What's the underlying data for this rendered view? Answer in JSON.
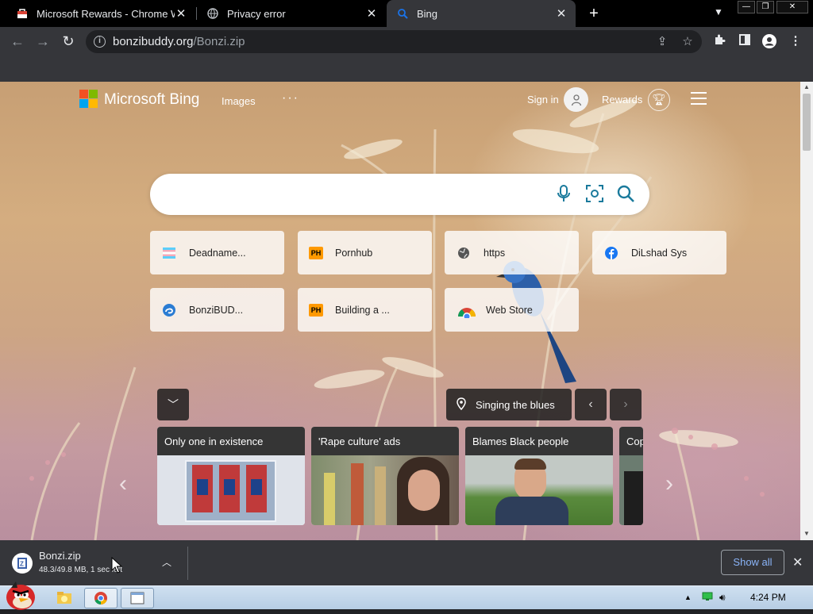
{
  "tabs": [
    {
      "title": "Microsoft Rewards - Chrome W",
      "active": false
    },
    {
      "title": "Privacy error",
      "active": false
    },
    {
      "title": "Bing",
      "active": true
    }
  ],
  "window_controls": {
    "minimize": "—",
    "restore": "❐",
    "close": "✕"
  },
  "address": {
    "domain": "bonzibuddy.org",
    "path": "/Bonzi.zip"
  },
  "bing": {
    "brand": "Microsoft Bing",
    "images_link": "Images",
    "more": "···",
    "signin": "Sign in",
    "rewards": "Rewards",
    "search_placeholder": ""
  },
  "quick_links": [
    {
      "label": "Deadname...",
      "icon": "trans-flag-icon"
    },
    {
      "label": "Pornhub",
      "icon": "ph-icon"
    },
    {
      "label": "https",
      "icon": "globe-icon"
    },
    {
      "label": "DiLshad Sys",
      "icon": "facebook-icon"
    },
    {
      "label": "BonziBUD...",
      "icon": "edge-icon"
    },
    {
      "label": "Building a ...",
      "icon": "ph-icon"
    },
    {
      "label": "Web Store",
      "icon": "chrome-icon"
    }
  ],
  "ph_badge": "PH",
  "carousel": {
    "location": "Singing the blues",
    "cards": [
      {
        "headline": "Only one in existence"
      },
      {
        "headline": "'Rape culture' ads"
      },
      {
        "headline": "Blames Black people"
      },
      {
        "headline": "Cop"
      }
    ]
  },
  "download": {
    "filename": "Bonzi.zip",
    "status": "48.3/49.8 MB, 1 sec left",
    "show_all": "Show all"
  },
  "taskbar": {
    "clock": "4:24 PM"
  },
  "colors": {
    "accent_search": "#1a7a9c",
    "download_link": "#8ab4f8"
  }
}
